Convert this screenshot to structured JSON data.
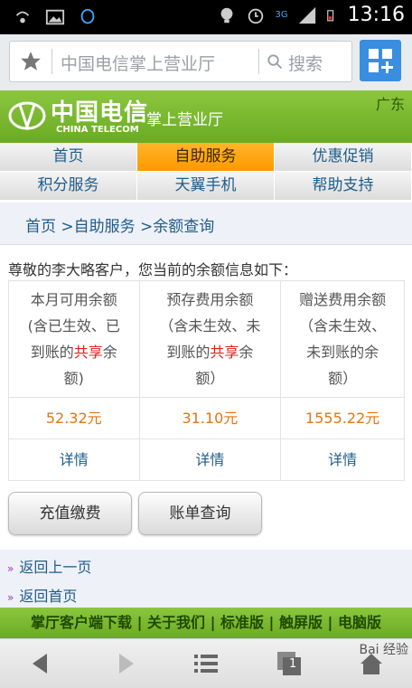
{
  "status_bar": {
    "time": "13:16",
    "network": "3G"
  },
  "browser": {
    "url_text": "中国电信掌上营业厅",
    "search_label": "搜索"
  },
  "header": {
    "brand_cn": "中国电信",
    "brand_en": "CHINA TELECOM",
    "subtitle": "掌上营业厅",
    "region": "广东"
  },
  "nav": {
    "row1": [
      {
        "label": "首页"
      },
      {
        "label": "自助服务",
        "active": true
      },
      {
        "label": "优惠促销"
      }
    ],
    "row2": [
      {
        "label": "积分服务"
      },
      {
        "label": "天翼手机"
      },
      {
        "label": "帮助支持"
      }
    ]
  },
  "breadcrumb": "首页 >自助服务 >余额查询",
  "greeting": "尊敬的李大略客户，您当前的余额信息如下：",
  "balance": {
    "columns": [
      {
        "title_a": "本月可用余额",
        "title_b": "(含已生效、已",
        "title_c": "到账的",
        "title_hl": "共享",
        "title_d": "余",
        "title_e": "额)",
        "value": "52.32元",
        "detail": "详情"
      },
      {
        "title_a": "预存费用余额",
        "title_b": "（含未生效、未",
        "title_c": "到账的",
        "title_hl": "共享",
        "title_d": "余",
        "title_e": "额）",
        "value": "31.10元",
        "detail": "详情"
      },
      {
        "title_a": "赠送费用余额",
        "title_b": "（含未生效、",
        "title_c": "未到账的余",
        "title_hl": "",
        "title_d": "",
        "title_e": "额）",
        "value": "1555.22元",
        "detail": "详情"
      }
    ]
  },
  "buttons": {
    "recharge": "充值缴费",
    "bill": "账单查询"
  },
  "links": {
    "back": "返回上一页",
    "home": "返回首页"
  },
  "footer": "掌厅客户端下载 | 关于我们 | 标准版 | 触屏版 | 电脑版",
  "toolbar": {
    "tabs_count": "1"
  },
  "watermark": "Bai 经验",
  "colors": {
    "brand_green": "#7ab92f",
    "nav_active": "#ff9f1a",
    "link_blue": "#1f5c8a",
    "value_orange": "#e6750e",
    "share_red": "#e02020"
  }
}
